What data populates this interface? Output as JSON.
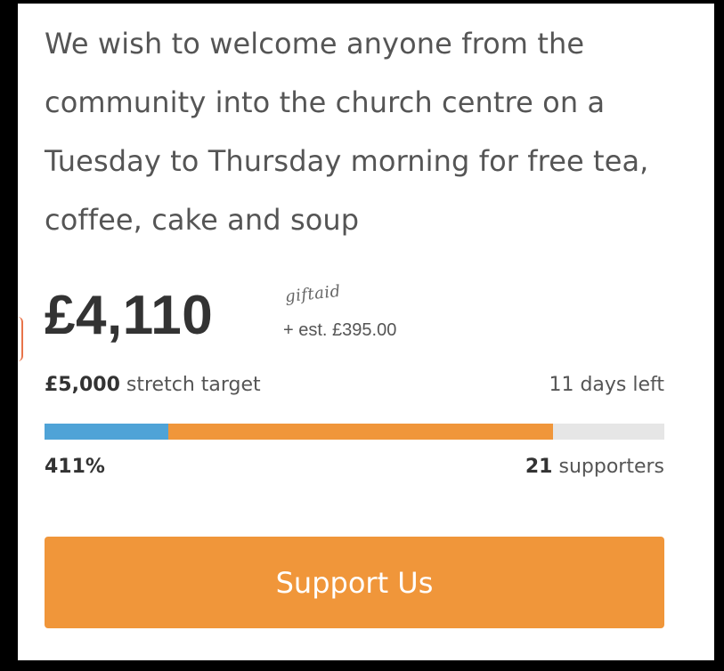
{
  "description": "We wish to welcome anyone from the community into the church centre on a Tuesday to Thursday morning for free tea, coffee, cake and soup",
  "amount_raised": "£4,110",
  "giftaid": {
    "logo_text": "giftaid",
    "estimate": "+ est. £395.00"
  },
  "target": {
    "amount": "£5,000",
    "label": "stretch target"
  },
  "days_left": "11 days left",
  "progress": {
    "percent_text": "411%",
    "blue_fraction": 0.2,
    "orange_fraction": 0.82,
    "colors": {
      "blue": "#4fa3d7",
      "orange": "#f0963a",
      "track": "#e6e6e6"
    }
  },
  "supporters": {
    "count": "21",
    "label": "supporters"
  },
  "button": {
    "label": "Support Us",
    "color": "#f0963a"
  }
}
